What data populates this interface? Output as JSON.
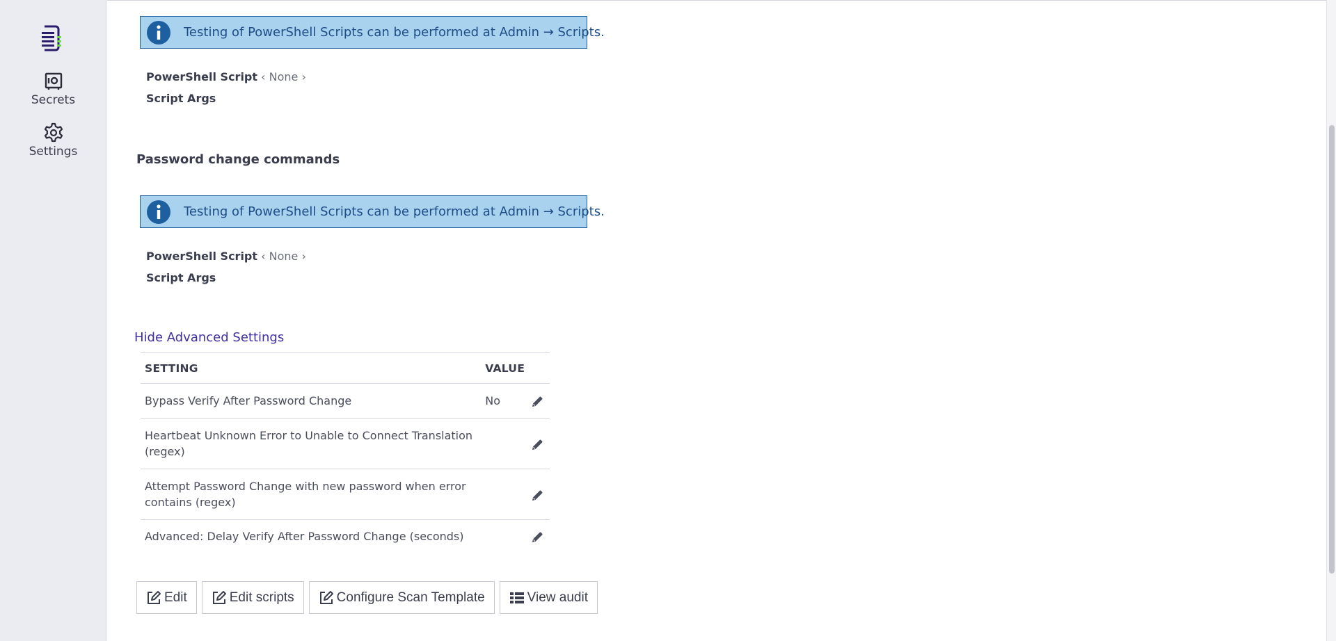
{
  "nav": {
    "logo_icon": "thycotic-logo-icon",
    "items": [
      {
        "label": "Secrets",
        "icon": "secrets-safe-icon"
      },
      {
        "label": "Settings",
        "icon": "gear-icon"
      }
    ]
  },
  "heartbeat": {
    "info_text": "Testing of PowerShell Scripts can be performed at Admin → Scripts.",
    "script_label": "PowerShell Script",
    "script_value": "‹ None ›",
    "args_label": "Script Args"
  },
  "password_change": {
    "title": "Password change commands",
    "info_text": "Testing of PowerShell Scripts can be performed at Admin → Scripts.",
    "script_label": "PowerShell Script",
    "script_value": "‹ None ›",
    "args_label": "Script Args"
  },
  "advanced": {
    "toggle_label": "Hide Advanced Settings",
    "columns": [
      "SETTING",
      "VALUE"
    ],
    "rows": [
      {
        "setting": "Bypass Verify After Password Change",
        "value": "No"
      },
      {
        "setting": "Heartbeat Unknown Error to Unable to Connect Translation (regex)",
        "value": ""
      },
      {
        "setting": "Attempt Password Change with new password when error contains (regex)",
        "value": ""
      },
      {
        "setting": "Advanced: Delay Verify After Password Change (seconds)",
        "value": ""
      }
    ]
  },
  "buttons": {
    "edit": "Edit",
    "edit_scripts": "Edit scripts",
    "configure_scan_template": "Configure Scan Template",
    "view_audit": "View audit"
  },
  "colors": {
    "info_bg": "#a9d2ef",
    "info_border": "#1e5fa0",
    "link": "#3e2fa3",
    "rail_bg": "#ebecf1",
    "logo_accent": "#6fdc54"
  }
}
